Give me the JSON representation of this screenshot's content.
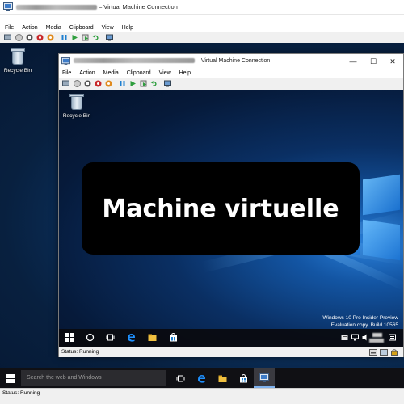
{
  "outer_window": {
    "title_suffix": "– Virtual Machine Connection",
    "menu": [
      "File",
      "Action",
      "Media",
      "Clipboard",
      "View",
      "Help"
    ],
    "status": "Status: Running"
  },
  "outer_desktop": {
    "recycle_bin_label": "Recycle Bin",
    "search_placeholder": "Search the web and Windows"
  },
  "inner_window": {
    "title_suffix": "– Virtual Machine Connection",
    "menu": [
      "File",
      "Action",
      "Media",
      "Clipboard",
      "View",
      "Help"
    ],
    "controls": {
      "minimize": "—",
      "maximize": "☐",
      "close": "✕"
    },
    "status": "Status: Running"
  },
  "inner_desktop": {
    "recycle_bin_label": "Recycle Bin",
    "watermark_line1": "Windows 10 Pro Insider Preview",
    "watermark_line2": "Evaluation copy. Build 10565"
  },
  "overlay_label": "Machine virtuelle",
  "colors": {
    "toolbar_green": "#2e9e3e",
    "toolbar_red": "#c8282a",
    "toolbar_orange": "#e08a1e",
    "edge_blue": "#1e90ff"
  }
}
